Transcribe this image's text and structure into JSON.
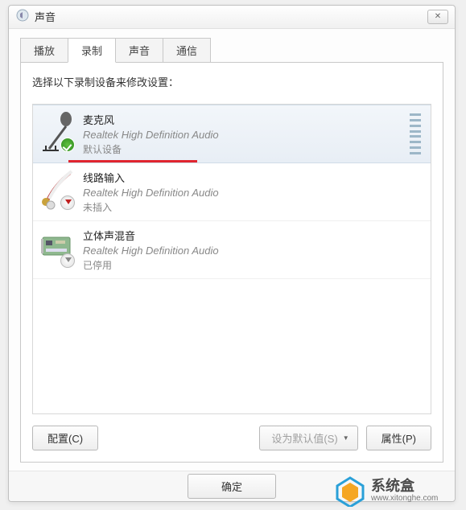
{
  "window": {
    "title": "声音"
  },
  "tabs": [
    {
      "label": "播放",
      "active": false
    },
    {
      "label": "录制",
      "active": true
    },
    {
      "label": "声音",
      "active": false
    },
    {
      "label": "通信",
      "active": false
    }
  ],
  "panel": {
    "instruction": "选择以下录制设备来修改设置：",
    "devices": [
      {
        "name": "麦克风",
        "driver": "Realtek High Definition Audio",
        "status": "默认设备",
        "badge": "check",
        "selected": true,
        "meter": true
      },
      {
        "name": "线路输入",
        "driver": "Realtek High Definition Audio",
        "status": "未插入",
        "badge": "down-red",
        "selected": false,
        "meter": false
      },
      {
        "name": "立体声混音",
        "driver": "Realtek High Definition Audio",
        "status": "已停用",
        "badge": "down-gray",
        "selected": false,
        "meter": false
      }
    ]
  },
  "buttons": {
    "configure": "配置(C)",
    "set_default": "设为默认值(S)",
    "properties": "属性(P)",
    "ok": "确定"
  },
  "watermark": {
    "cn": "系统盒",
    "en": "www.xitonghe.com"
  }
}
